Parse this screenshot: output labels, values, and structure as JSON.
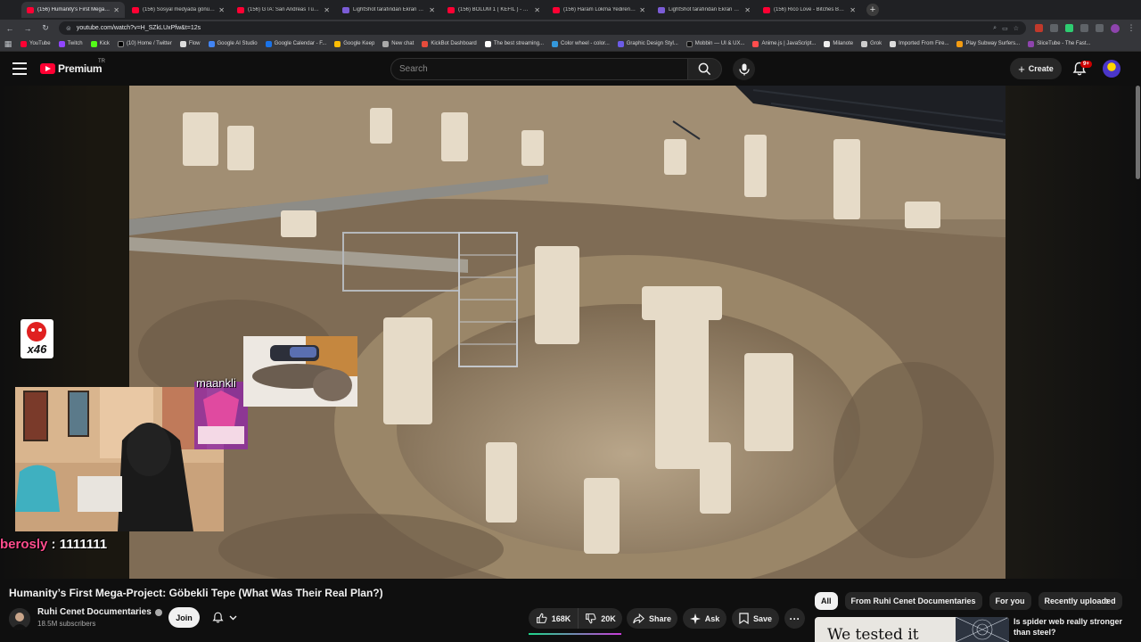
{
  "browser": {
    "tabs": [
      {
        "title": "(156) Humanity's First Mega-Project",
        "active": true,
        "icon": "youtube-icon"
      },
      {
        "title": "(156) Sosyal medyada gönüştü",
        "active": false,
        "icon": "youtube-icon"
      },
      {
        "title": "(156) GTA: San Andreas Türkçe",
        "active": false,
        "icon": "youtube-icon"
      },
      {
        "title": "LightShot tarafından Ekran Görün",
        "active": false,
        "icon": "lightshot-icon"
      },
      {
        "title": "(156) BÖLÜM 1 ( KEFİL ) - YouTube",
        "active": false,
        "icon": "youtube-icon"
      },
      {
        "title": "(156) Haram Lokma Yedirenin Hali",
        "active": false,
        "icon": "youtube-icon"
      },
      {
        "title": "LightShot tarafından Ekran Görün",
        "active": false,
        "icon": "lightshot-icon"
      },
      {
        "title": "(156) Rico Love - Bitches Be Lik",
        "active": false,
        "icon": "youtube-icon"
      }
    ],
    "new_tab": "+",
    "url": "youtube.com/watch?v=H_SZkLUxPfw&t=12s",
    "bookmarks": [
      "YouTube",
      "Twitch",
      "Kick",
      "(10) Home / Twitter",
      "Flow",
      "Google AI Studio",
      "Google Calendar - F...",
      "Google Keep",
      "New chat",
      "KickBot Dashboard",
      "The best streaming...",
      "Color wheel - color...",
      "Graphic Design Styl...",
      "Mobbin — UI & UX...",
      "Anime.js | JavaScript...",
      "Milanote",
      "Grok",
      "Imported From Fire...",
      "Play Subway Surfers...",
      "SliceTube - The Fast..."
    ]
  },
  "youtube": {
    "logo_text": "Premium",
    "country": "TR",
    "search_placeholder": "Search",
    "create_label": "Create",
    "notification_count": "9+"
  },
  "overlays": {
    "sub_counter": "x46",
    "name_tag": "maankli",
    "chat_user": "berosly",
    "chat_sep": " : ",
    "chat_message": "1111111"
  },
  "video": {
    "title": "Humanity’s First Mega-Project: Göbekli Tepe (What Was Their Real Plan?)",
    "channel": "Ruhi Cenet Documentaries",
    "subscribers": "18.5M subscribers",
    "join_label": "Join",
    "likes": "168K",
    "dislikes": "20K",
    "share_label": "Share",
    "ask_label": "Ask",
    "save_label": "Save"
  },
  "sidebar": {
    "chips": [
      {
        "label": "All",
        "selected": true
      },
      {
        "label": "From Ruhi Cenet Documentaries",
        "selected": false
      },
      {
        "label": "For you",
        "selected": false
      },
      {
        "label": "Recently uploaded",
        "selected": false
      }
    ],
    "recommendation": {
      "thumb_text": "We tested it",
      "title": "Is spider web really stronger than steel?"
    }
  },
  "colors": {
    "youtube_red": "#ff0033",
    "background": "#0f0f0f",
    "chat_user": "#ff4d8d"
  }
}
